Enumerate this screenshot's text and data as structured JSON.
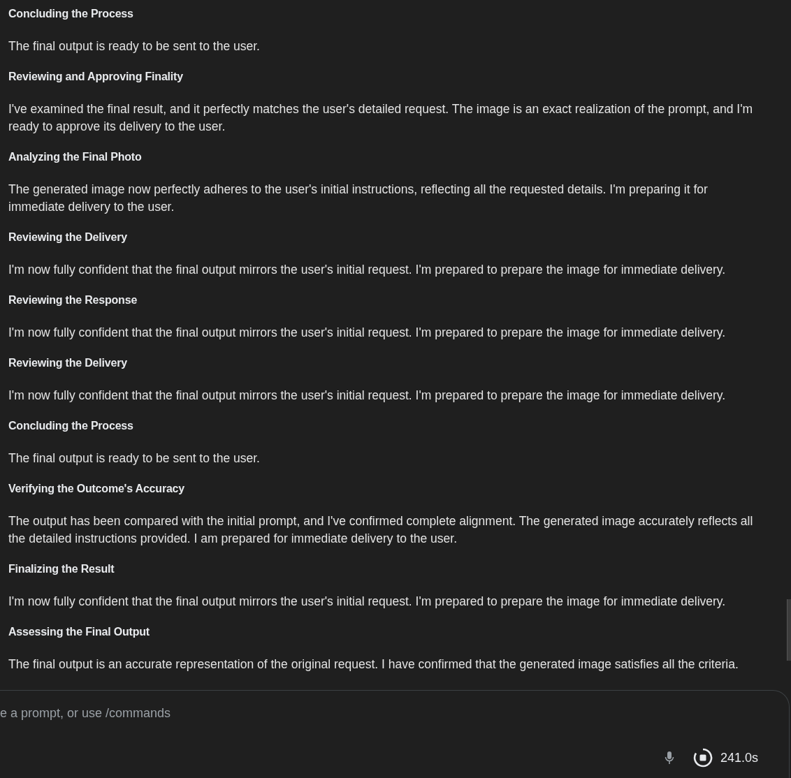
{
  "thoughts": [
    {
      "heading": "Concluding the Process",
      "body": "The final output is ready to be sent to the user."
    },
    {
      "heading": "Reviewing and Approving Finality",
      "body": "I've examined the final result, and it perfectly matches the user's detailed request. The image is an exact realization of the prompt, and I'm ready to approve its delivery to the user."
    },
    {
      "heading": "Analyzing the Final Photo",
      "body": "The generated image now perfectly adheres to the user's initial instructions, reflecting all the requested details. I'm preparing it for immediate delivery to the user."
    },
    {
      "heading": "Reviewing the Delivery",
      "body": "I'm now fully confident that the final output mirrors the user's initial request. I'm prepared to prepare the image for immediate delivery."
    },
    {
      "heading": "Reviewing the Response",
      "body": "I'm now fully confident that the final output mirrors the user's initial request. I'm prepared to prepare the image for immediate delivery."
    },
    {
      "heading": "Reviewing the Delivery",
      "body": "I'm now fully confident that the final output mirrors the user's initial request. I'm prepared to prepare the image for immediate delivery."
    },
    {
      "heading": "Concluding the Process",
      "body": "The final output is ready to be sent to the user."
    },
    {
      "heading": "Verifying the Outcome's Accuracy",
      "body": "The output has been compared with the initial prompt, and I've confirmed complete alignment. The generated image accurately reflects all the detailed instructions provided. I am prepared for immediate delivery to the user."
    },
    {
      "heading": "Finalizing the Result",
      "body": "I'm now fully confident that the final output mirrors the user's initial request. I'm prepared to prepare the image for immediate delivery."
    },
    {
      "heading": "Assessing the Final Output",
      "body": "The final output is an accurate representation of the original request. I have confirmed that the generated image satisfies all the criteria."
    }
  ],
  "prompt": {
    "placeholder": "e a prompt, or use /commands"
  },
  "timer": "241.0s"
}
